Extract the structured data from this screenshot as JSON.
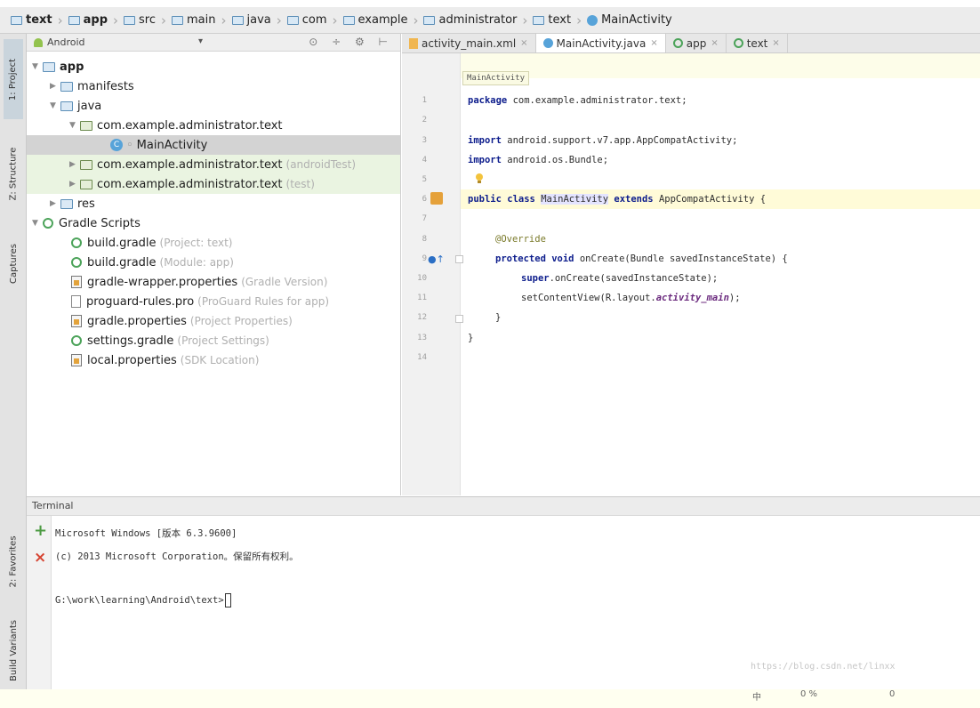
{
  "breadcrumb": [
    "text",
    "app",
    "src",
    "main",
    "java",
    "com",
    "example",
    "administrator",
    "text",
    "MainActivity"
  ],
  "left_strip": {
    "project_tab": "1: Project",
    "structure_tab": "Z: Structure",
    "captures_tab": "Captures",
    "favorites_tab": "2: Favorites",
    "build_variants_tab": "Build Variants"
  },
  "project": {
    "view_mode": "Android",
    "dropdown_glyph": "▾",
    "tools_glyphs": "⊙ ÷ ⚙ ⊢",
    "tree": [
      {
        "label": "app",
        "note": ""
      },
      {
        "label": "manifests",
        "note": ""
      },
      {
        "label": "java",
        "note": ""
      },
      {
        "label": "com.example.administrator.text",
        "note": ""
      },
      {
        "label": "MainActivity",
        "note": ""
      },
      {
        "label": "com.example.administrator.text",
        "note": "(androidTest)"
      },
      {
        "label": "com.example.administrator.text",
        "note": "(test)"
      },
      {
        "label": "res",
        "note": ""
      },
      {
        "label": "Gradle Scripts",
        "note": ""
      },
      {
        "label": "build.gradle",
        "note": "(Project: text)"
      },
      {
        "label": "build.gradle",
        "note": "(Module: app)"
      },
      {
        "label": "gradle-wrapper.properties",
        "note": "(Gradle Version)"
      },
      {
        "label": "proguard-rules.pro",
        "note": "(ProGuard Rules for app)"
      },
      {
        "label": "gradle.properties",
        "note": "(Project Properties)"
      },
      {
        "label": "settings.gradle",
        "note": "(Project Settings)"
      },
      {
        "label": "local.properties",
        "note": "(SDK Location)"
      }
    ]
  },
  "editor": {
    "tabs": [
      {
        "label": "activity_main.xml",
        "close": "×"
      },
      {
        "label": "MainActivity.java",
        "close": "×"
      },
      {
        "label": "app",
        "close": "×"
      },
      {
        "label": "text",
        "close": "×"
      }
    ],
    "scope_label": "MainActivity",
    "line_numbers": [
      "1",
      "2",
      "3",
      "4",
      "5",
      "6",
      "7",
      "8",
      "9",
      "10",
      "11",
      "12",
      "13",
      "14"
    ],
    "code": {
      "l1_kw": "package",
      "l1_rest": " com.example.administrator.text;",
      "l3_kw": "import",
      "l3_rest": " android.support.v7.app.AppCompatActivity;",
      "l4_kw": "import",
      "l4_rest": " android.os.Bundle;",
      "l6_kw": "public class",
      "l6_name": "MainActivity",
      "l6_kw2": "extends",
      "l6_rest": " AppCompatActivity {",
      "l8_ann": "@Override",
      "l9_kw": "protected void",
      "l9_rest": " onCreate(Bundle savedInstanceState) {",
      "l10_kw": "super",
      "l10_rest": ".onCreate(savedInstanceState);",
      "l11_pre": "setContentView(R.layout.",
      "l11_field": "activity_main",
      "l11_post": ");",
      "l12": "}",
      "l13": "}"
    }
  },
  "terminal": {
    "title": "Terminal",
    "add_glyph": "+",
    "close_glyph": "×",
    "lines": [
      "Microsoft Windows [版本 6.3.9600]",
      "(c) 2013 Microsoft Corporation。保留所有权利。",
      "G:\\work\\learning\\Android\\text>"
    ],
    "watermark": "https://blog.csdn.net/linxx"
  },
  "bottom_fragments": [
    "中",
    "0 %",
    "0"
  ]
}
